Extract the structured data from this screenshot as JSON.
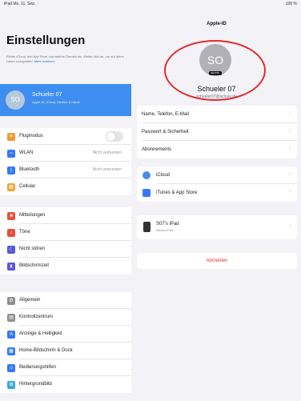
{
  "status_bar": {
    "left": "iPad  Mo. 11. Sep.",
    "right": "100 %"
  },
  "sidebar": {
    "title": "Einstellungen",
    "description": "Richte iCloud, den App Store und weitere Dienste ein. Melde dich an, um auf deine Daten zuzugreifen.",
    "description_link": "Mehr erfahren",
    "profile": {
      "initials": "SO",
      "name": "Schueler 07",
      "subtitle": "Apple-ID, iCloud, Medien & Käufe"
    },
    "group1": [
      {
        "label": "Flugmodus",
        "icon_color": "#f19a37",
        "icon": "airplane-icon",
        "type": "toggle"
      },
      {
        "label": "WLAN",
        "icon_color": "#3478f6",
        "icon": "wifi-icon",
        "value": "Nicht verbunden"
      },
      {
        "label": "Bluetooth",
        "icon_color": "#3478f6",
        "icon": "bluetooth-icon",
        "value": "Nicht verbunden"
      },
      {
        "label": "Cellular",
        "icon_color": "#f2a33a",
        "icon": "cellular-icon"
      }
    ],
    "group2": [
      {
        "label": "Mitteilungen",
        "icon_color": "#eb4d3d",
        "icon": "notifications-icon"
      },
      {
        "label": "Töne",
        "icon_color": "#eb4d3d",
        "icon": "sounds-icon"
      },
      {
        "label": "Nicht stören",
        "icon_color": "#5856d6",
        "icon": "moon-icon"
      },
      {
        "label": "Bildschirmzeit",
        "icon_color": "#5856d6",
        "icon": "hourglass-icon"
      }
    ],
    "group3": [
      {
        "label": "Allgemein",
        "icon_color": "#8e8e93",
        "icon": "gear-icon"
      },
      {
        "label": "Kontrollzentrum",
        "icon_color": "#8e8e93",
        "icon": "control-center-icon"
      },
      {
        "label": "Anzeige & Helligkeit",
        "icon_color": "#3478f6",
        "icon": "brightness-icon"
      },
      {
        "label": "Home-Bildschirm & Dock",
        "icon_color": "#3478f6",
        "icon": "home-screen-icon"
      },
      {
        "label": "Bedienungshilfen",
        "icon_color": "#3478f6",
        "icon": "accessibility-icon"
      },
      {
        "label": "Hintergrundbild",
        "icon_color": "#35aadc",
        "icon": "wallpaper-icon"
      }
    ]
  },
  "main": {
    "title": "Apple-ID",
    "avatar_initials": "SO",
    "avatar_badge": "BEARB.",
    "name": "Schueler 07",
    "subtitle": "schueler07@schule.de",
    "group1": [
      {
        "label": "Name, Telefon, E-Mail"
      },
      {
        "label": "Passwort & Sicherheit"
      },
      {
        "label": "Abonnements"
      }
    ],
    "group2": [
      {
        "label": "iCloud",
        "icon_color": "#4a90e2",
        "icon": "icloud-icon"
      },
      {
        "label": "iTunes & App Store",
        "icon_color": "#3478f6",
        "icon": "app-store-icon"
      }
    ],
    "device": {
      "name": "S07's iPad",
      "subtitle": "Dieses iPad"
    },
    "signout": "Abmelden"
  }
}
